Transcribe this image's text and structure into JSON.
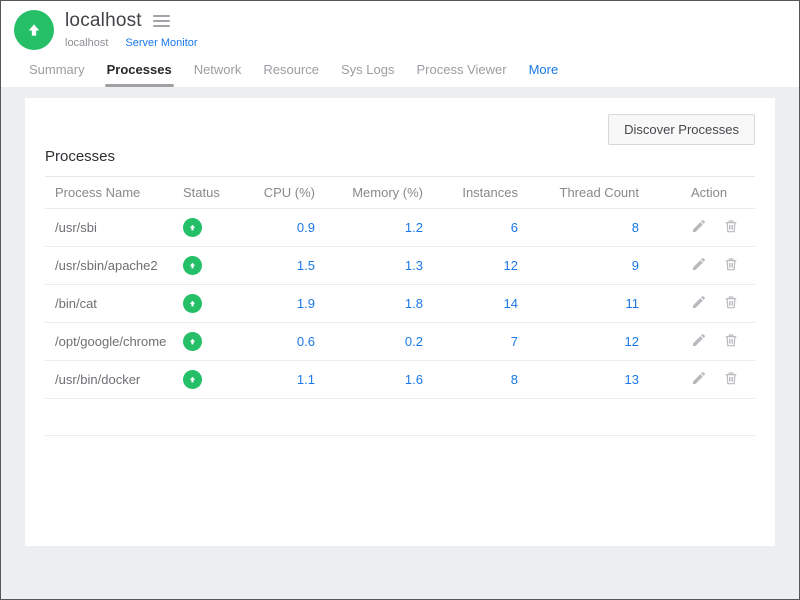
{
  "header": {
    "title": "localhost",
    "breadcrumb_host": "localhost",
    "breadcrumb_monitor": "Server Monitor"
  },
  "tabs": {
    "summary": "Summary",
    "processes": "Processes",
    "network": "Network",
    "resource": "Resource",
    "sys_logs": "Sys Logs",
    "process_viewer": "Process Viewer",
    "more": "More"
  },
  "content": {
    "discover_button": "Discover Processes",
    "section_title": "Processes",
    "table": {
      "headers": {
        "name": "Process Name",
        "status": "Status",
        "cpu": "CPU (%)",
        "memory": "Memory (%)",
        "instances": "Instances",
        "threads": "Thread Count",
        "action": "Action"
      },
      "rows": [
        {
          "name": "/usr/sbi",
          "status": "up",
          "cpu": "0.9",
          "memory": "1.2",
          "instances": "6",
          "threads": "8"
        },
        {
          "name": "/usr/sbin/apache2",
          "status": "up",
          "cpu": "1.5",
          "memory": "1.3",
          "instances": "12",
          "threads": "9"
        },
        {
          "name": "/bin/cat",
          "status": "up",
          "cpu": "1.9",
          "memory": "1.8",
          "instances": "14",
          "threads": "11"
        },
        {
          "name": "/opt/google/chrome",
          "status": "up",
          "cpu": "0.6",
          "memory": "0.2",
          "instances": "7",
          "threads": "12"
        },
        {
          "name": "/usr/bin/docker",
          "status": "up",
          "cpu": "1.1",
          "memory": "1.6",
          "instances": "8",
          "threads": "13"
        }
      ]
    }
  },
  "colors": {
    "status_green": "#25bf68",
    "link_blue": "#1a78e8",
    "active_tab_text": "#28292c",
    "page_background": "#edeef0"
  }
}
